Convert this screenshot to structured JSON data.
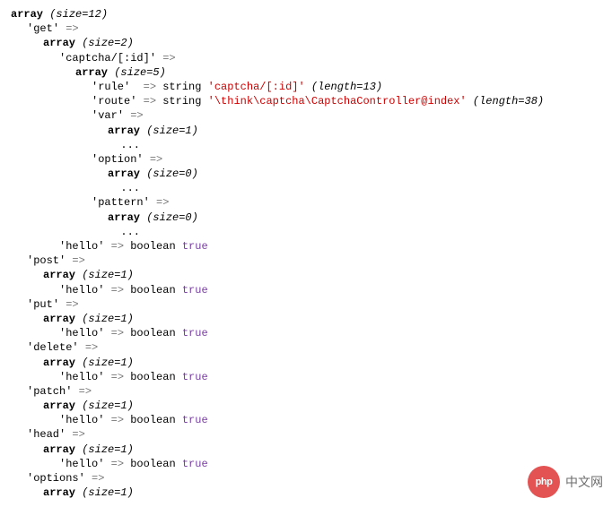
{
  "dump": {
    "root_type": "array",
    "root_size": "(size=12)",
    "methods": [
      {
        "name": "get",
        "array_size": "(size=2)",
        "children": [
          {
            "key": "captcha/[:id]",
            "array_size": "(size=5)",
            "entries": [
              {
                "key": "rule",
                "type": "string",
                "value": "'captcha/[:id]'",
                "length": "(length=13)"
              },
              {
                "key": "route",
                "type": "string",
                "value": "'\\think\\captcha\\CaptchaController@index'",
                "length": "(length=38)"
              }
            ],
            "nested": [
              {
                "key": "var",
                "array_size": "(size=1)"
              },
              {
                "key": "option",
                "array_size": "(size=0)"
              },
              {
                "key": "pattern",
                "array_size": "(size=0)"
              }
            ]
          },
          {
            "key": "hello",
            "bool": "true"
          }
        ]
      },
      {
        "name": "post",
        "array_size": "(size=1)",
        "hello_key": "hello",
        "bool": "true"
      },
      {
        "name": "put",
        "array_size": "(size=1)",
        "hello_key": "hello",
        "bool": "true"
      },
      {
        "name": "delete",
        "array_size": "(size=1)",
        "hello_key": "hello",
        "bool": "true"
      },
      {
        "name": "patch",
        "array_size": "(size=1)",
        "hello_key": "hello",
        "bool": "true"
      },
      {
        "name": "head",
        "array_size": "(size=1)",
        "hello_key": "hello",
        "bool": "true"
      },
      {
        "name": "options",
        "array_size": "(size=1)"
      }
    ],
    "arrow": "=>",
    "type_boolean": "boolean",
    "type_string": "string",
    "ellipsis": "..."
  },
  "watermark": {
    "logo": "php",
    "text": "中文网"
  }
}
